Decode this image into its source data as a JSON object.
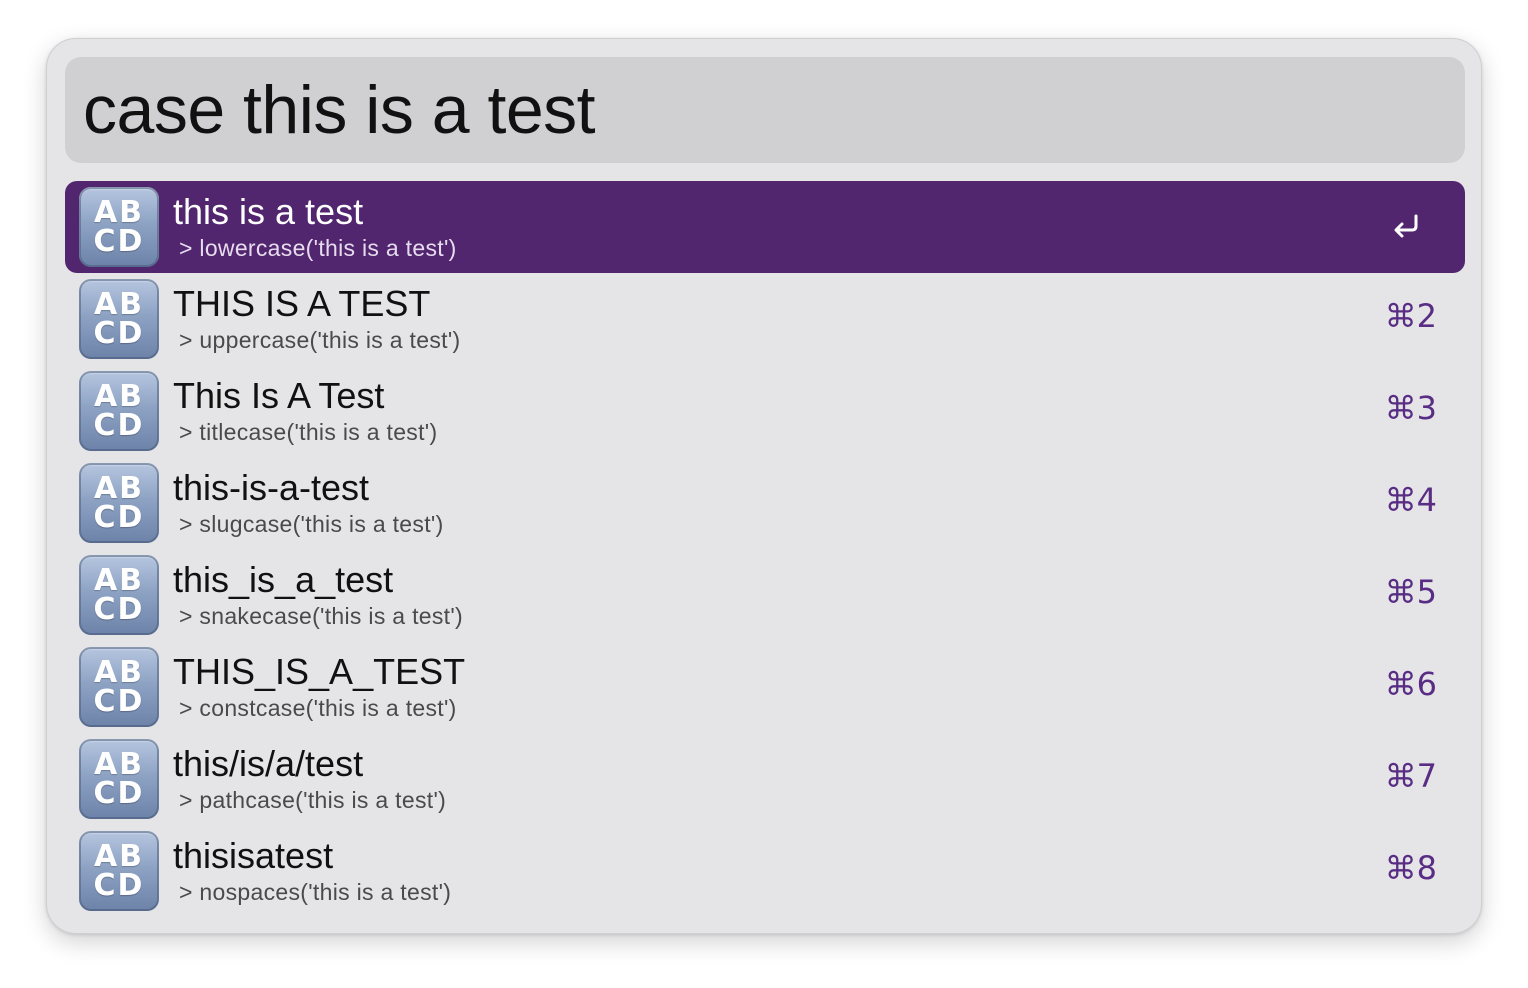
{
  "search": {
    "query": "case this is a test"
  },
  "results": [
    {
      "icon_text": [
        "AB",
        "CD"
      ],
      "title": "this is a test",
      "subtitle": "> lowercase('this is a test')",
      "shortcut": "",
      "selected": true
    },
    {
      "icon_text": [
        "AB",
        "CD"
      ],
      "title": "THIS IS A TEST",
      "subtitle": "> uppercase('this is a test')",
      "shortcut": "⌘2",
      "selected": false
    },
    {
      "icon_text": [
        "AB",
        "CD"
      ],
      "title": "This Is A Test",
      "subtitle": "> titlecase('this is a test')",
      "shortcut": "⌘3",
      "selected": false
    },
    {
      "icon_text": [
        "AB",
        "CD"
      ],
      "title": "this-is-a-test",
      "subtitle": "> slugcase('this is a test')",
      "shortcut": "⌘4",
      "selected": false
    },
    {
      "icon_text": [
        "AB",
        "CD"
      ],
      "title": "this_is_a_test",
      "subtitle": "> snakecase('this is a test')",
      "shortcut": "⌘5",
      "selected": false
    },
    {
      "icon_text": [
        "AB",
        "CD"
      ],
      "title": "THIS_IS_A_TEST",
      "subtitle": "> constcase('this is a test')",
      "shortcut": "⌘6",
      "selected": false
    },
    {
      "icon_text": [
        "AB",
        "CD"
      ],
      "title": "this/is/a/test",
      "subtitle": "> pathcase('this is a test')",
      "shortcut": "⌘7",
      "selected": false
    },
    {
      "icon_text": [
        "AB",
        "CD"
      ],
      "title": "thisisatest",
      "subtitle": "> nospaces('this is a test')",
      "shortcut": "⌘8",
      "selected": false
    }
  ],
  "icons": {
    "result_icon": "abcd-input-icon",
    "selected_action": "return-key-icon"
  },
  "colors": {
    "selection": "#52266e",
    "shortcut": "#5a2d85",
    "window_bg": "#e5e5e8",
    "search_bg": "#d0d0d3"
  }
}
